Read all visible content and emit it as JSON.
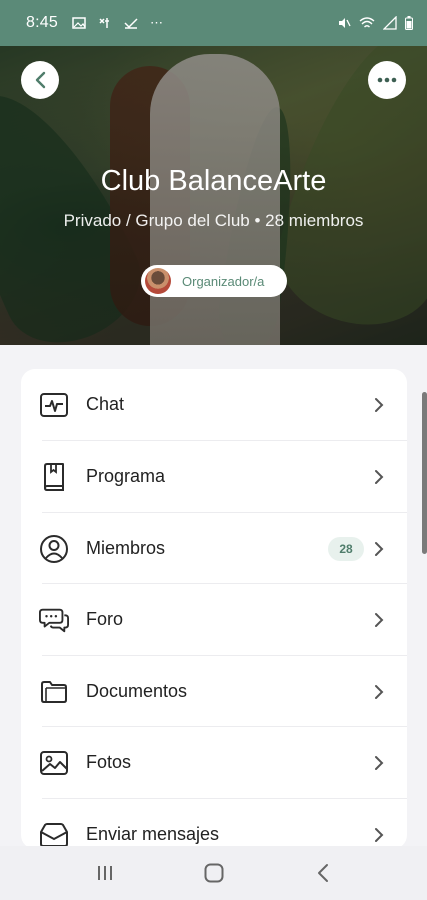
{
  "status_bar": {
    "time": "8:45",
    "left_icons": [
      "image-icon",
      "tool-icon",
      "check-icon",
      "more-dots-icon"
    ],
    "right_icons": [
      "mute-icon",
      "wifi-icon",
      "signal-icon",
      "battery-icon"
    ]
  },
  "hero": {
    "title": "Club BalanceArte",
    "subtitle": "Privado / Grupo del Club • 28 miembros",
    "organizer_label": "Organizador/a"
  },
  "menu": {
    "items": [
      {
        "label": "Chat",
        "icon": "chat-activity-icon"
      },
      {
        "label": "Programa",
        "icon": "book-icon"
      },
      {
        "label": "Miembros",
        "icon": "user-circle-icon",
        "badge": "28"
      },
      {
        "label": "Foro",
        "icon": "forum-bubbles-icon"
      },
      {
        "label": "Documentos",
        "icon": "folder-icon"
      },
      {
        "label": "Fotos",
        "icon": "photo-icon"
      },
      {
        "label": "Enviar mensajes",
        "icon": "envelope-icon"
      }
    ]
  },
  "colors": {
    "status_bar": "#5b8a78",
    "accent": "#5a8a76",
    "badge_bg": "#e8f1ed"
  },
  "nav_bar": [
    "recents-icon",
    "home-icon",
    "back-icon"
  ]
}
